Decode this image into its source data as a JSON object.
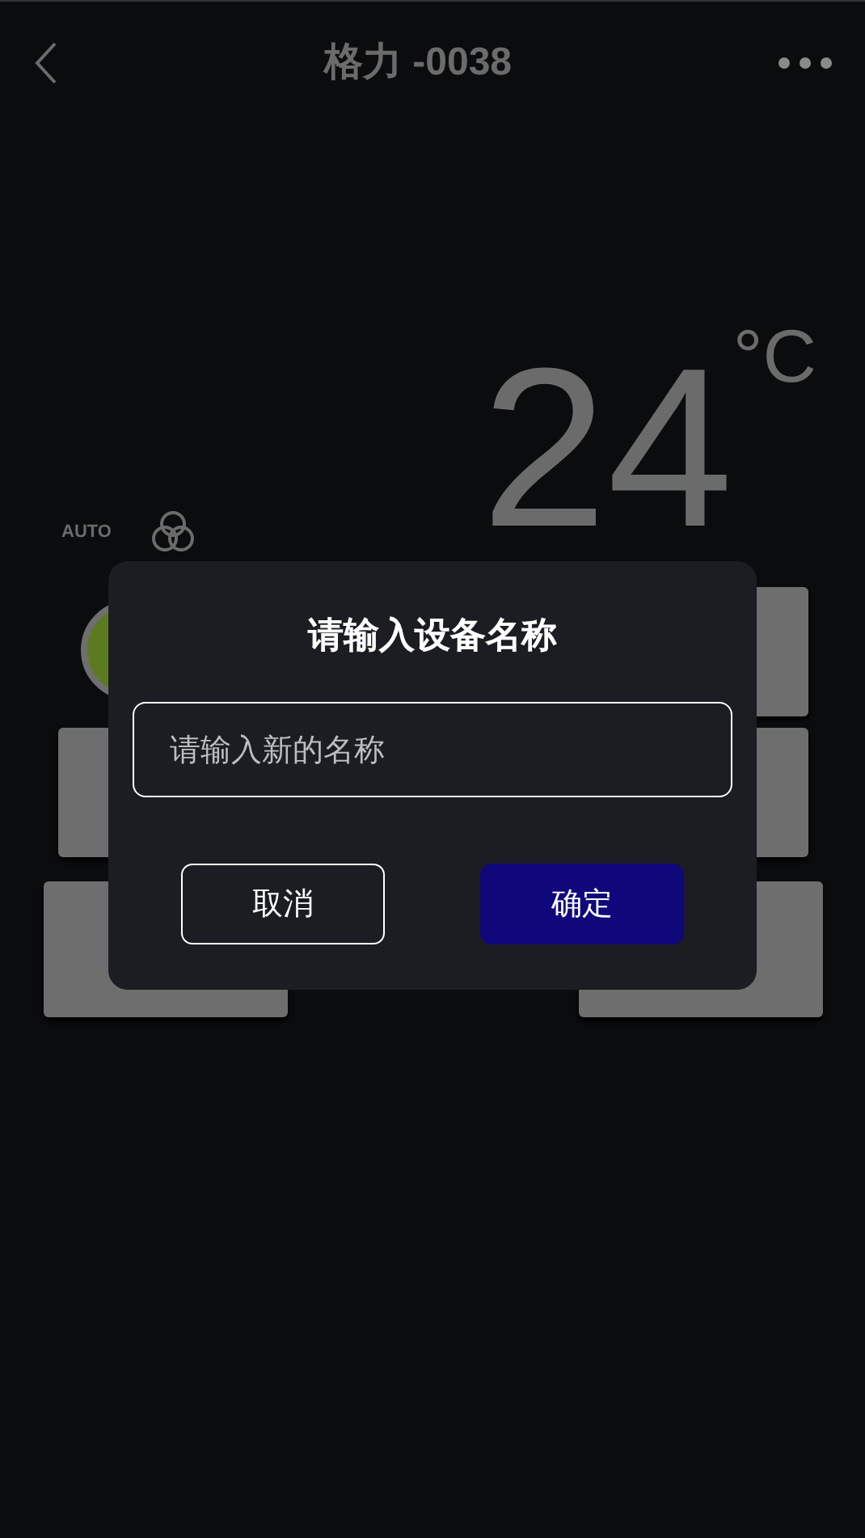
{
  "header": {
    "title": "格力 -0038"
  },
  "climate": {
    "temperature": "24",
    "unit": "°C",
    "mode": "AUTO"
  },
  "dialog": {
    "title": "请输入设备名称",
    "placeholder": "请输入新的名称",
    "buttons": [
      {
        "label": "取消",
        "kind": "secondary"
      },
      {
        "label": "确定",
        "kind": "primary"
      }
    ]
  }
}
